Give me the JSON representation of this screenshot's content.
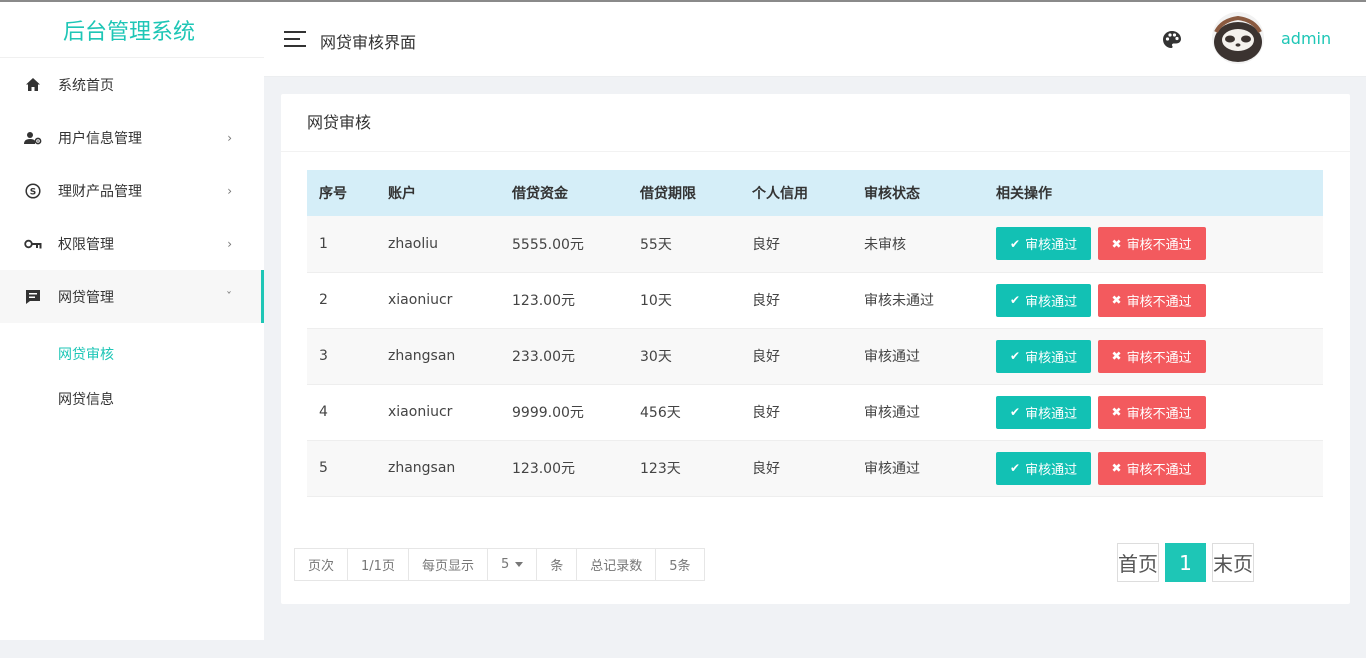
{
  "sidebar": {
    "brand": "后台管理系统",
    "items": [
      {
        "label": "系统首页",
        "icon": "home-icon",
        "chevron": ""
      },
      {
        "label": "用户信息管理",
        "icon": "user-settings-icon",
        "chevron": "›"
      },
      {
        "label": "理财产品管理",
        "icon": "dollar-icon",
        "chevron": "›"
      },
      {
        "label": "权限管理",
        "icon": "key-icon",
        "chevron": "›"
      },
      {
        "label": "网贷管理",
        "icon": "message-icon",
        "chevron": "ˇ"
      }
    ],
    "submenu": [
      {
        "label": "网贷审核"
      },
      {
        "label": "网贷信息"
      }
    ]
  },
  "header": {
    "title": "网贷审核界面",
    "username": "admin"
  },
  "card": {
    "title": "网贷审核"
  },
  "table": {
    "columns": [
      "序号",
      "账户",
      "借贷资金",
      "借贷期限",
      "个人信用",
      "审核状态",
      "相关操作"
    ],
    "approve_label": "审核通过",
    "reject_label": "审核不通过",
    "rows": [
      {
        "id": "1",
        "account": "zhaoliu",
        "amount": "5555.00元",
        "term": "55天",
        "credit": "良好",
        "status": "未审核"
      },
      {
        "id": "2",
        "account": "xiaoniucr",
        "amount": "123.00元",
        "term": "10天",
        "credit": "良好",
        "status": "审核未通过"
      },
      {
        "id": "3",
        "account": "zhangsan",
        "amount": "233.00元",
        "term": "30天",
        "credit": "良好",
        "status": "审核通过"
      },
      {
        "id": "4",
        "account": "xiaoniucr",
        "amount": "9999.00元",
        "term": "456天",
        "credit": "良好",
        "status": "审核通过"
      },
      {
        "id": "5",
        "account": "zhangsan",
        "amount": "123.00元",
        "term": "123天",
        "credit": "良好",
        "status": "审核通过"
      }
    ]
  },
  "pager": {
    "page_label": "页次",
    "page_value": "1/1页",
    "per_page_label": "每页显示",
    "per_page_value": "5",
    "unit": "条",
    "total_label": "总记录数",
    "total_value": "5条",
    "first": "首页",
    "current": "1",
    "last": "末页"
  },
  "colors": {
    "accent": "#1ec6b6",
    "approve": "#12c1b4",
    "reject": "#f35a5e",
    "table_header": "#d5eef8"
  }
}
